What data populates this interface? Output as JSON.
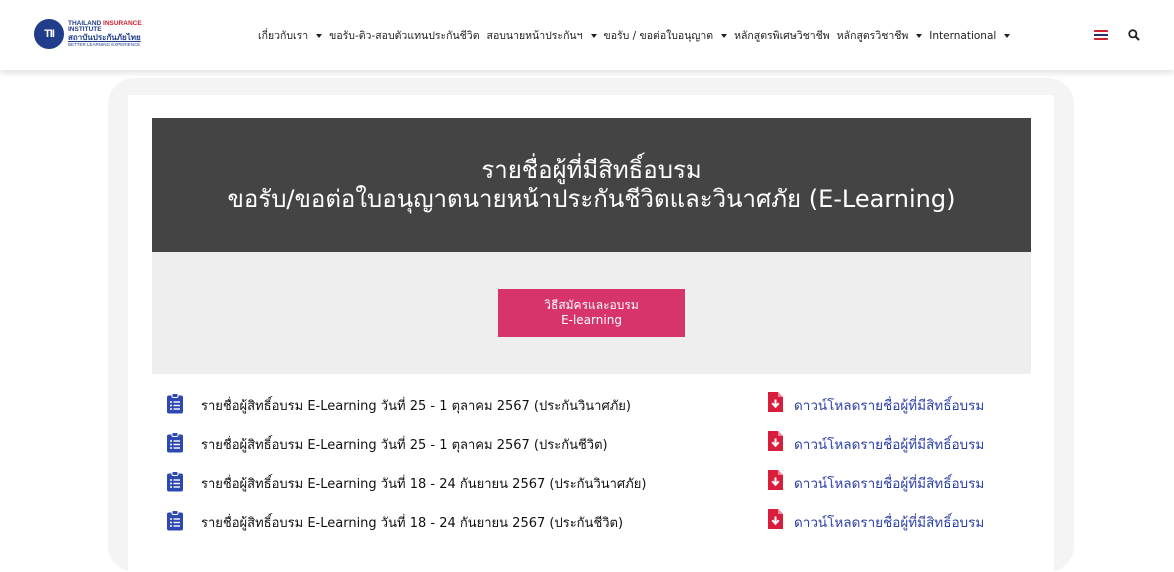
{
  "header": {
    "logo": {
      "mark": "TII",
      "line1_a": "THAILAND",
      "line1_b": "INSURANCE",
      "line2": "INSTITUTE",
      "line3": "สถาบันประกันภัยไทย",
      "line4": "BETTER LEARNING EXPERIENCE"
    },
    "nav": [
      {
        "label": "เกี่ยวกับเรา",
        "has_caret": true
      },
      {
        "label": "ขอรับ-ติว-สอบตัวแทนประกันชีวิต",
        "has_caret": false
      },
      {
        "label": "สอบนายหน้าประกันฯ",
        "has_caret": true
      },
      {
        "label": "ขอรับ / ขอต่อใบอนุญาต",
        "has_caret": true
      },
      {
        "label": "หลักสูตรพิเศษวิชาชีพ",
        "has_caret": false
      },
      {
        "label": "หลักสูตรวิชาชีพ",
        "has_caret": true
      },
      {
        "label": "International",
        "has_caret": true
      }
    ],
    "language_icon": "thai-flag-icon",
    "search_icon": "search-icon"
  },
  "banner": {
    "title_line1": "รายชื่อผู้ที่มีสิทธิ์อบรม",
    "title_line2": "ขอรับ/ขอต่อใบอนุญาตนายหน้าประกันชีวิตและวินาศภัย (E-Learning)"
  },
  "cta": {
    "line1": "วิธีสมัครและอบรม",
    "line2": "E-learning"
  },
  "list": [
    {
      "title": "รายชื่อผู้สิทธิ์อบรม E-Learning วันที่ 25 - 1 ตุลาคม 2567 (ประกันวินาศภัย)",
      "link": "ดาวน์โหลดรายชื่อผู้ที่มีสิทธิ์อบรม"
    },
    {
      "title": "รายชื่อผู้สิทธิ์อบรม E-Learning วันที่ 25 - 1 ตุลาคม 2567 (ประกันชีวิต)",
      "link": "ดาวน์โหลดรายชื่อผู้ที่มีสิทธิ์อบรม"
    },
    {
      "title": "รายชื่อผู้สิทธิ์อบรม E-Learning วันที่ 18 - 24 กันยายน 2567 (ประกันวินาศภัย)",
      "link": "ดาวน์โหลดรายชื่อผู้ที่มีสิทธิ์อบรม"
    },
    {
      "title": "รายชื่อผู้สิทธิ์อบรม E-Learning วันที่ 18 - 24 กันยายน 2567 (ประกันชีวิต)",
      "link": "ดาวน์โหลดรายชื่อผู้ที่มีสิทธิ์อบรม"
    }
  ],
  "colors": {
    "brand_blue": "#1f3d8a",
    "banner_bg": "#444444",
    "cta_pink": "#d6346b",
    "link_blue": "#2b3fa8",
    "pdf_red": "#d81e3c",
    "clipboard_blue": "#2d47b3"
  }
}
